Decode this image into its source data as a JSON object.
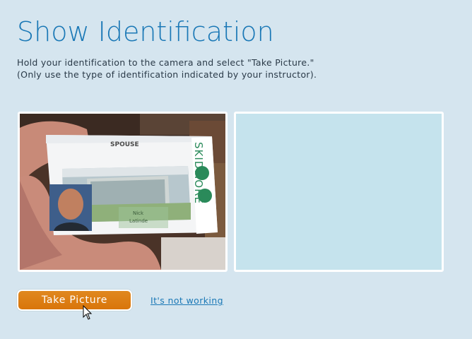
{
  "header": {
    "title": "Show Identification"
  },
  "instructions": {
    "line1": "Hold your identification to the camera and select \"Take Picture.\"",
    "line2": "(Only use the type of identification indicated by your instructor)."
  },
  "id_card": {
    "role_label": "SPOUSE",
    "institution_vertical": "SKIDMORE",
    "name_line1": "Nick",
    "name_line2": "Latinde"
  },
  "actions": {
    "take_picture_label": "Take Picture",
    "not_working_label": "It's not working"
  },
  "colors": {
    "background": "#d5e5ef",
    "title": "#1a78b6",
    "button": "#dd7f14",
    "captured_placeholder": "#c5e3ed",
    "card_green": "#2a8a5a"
  }
}
